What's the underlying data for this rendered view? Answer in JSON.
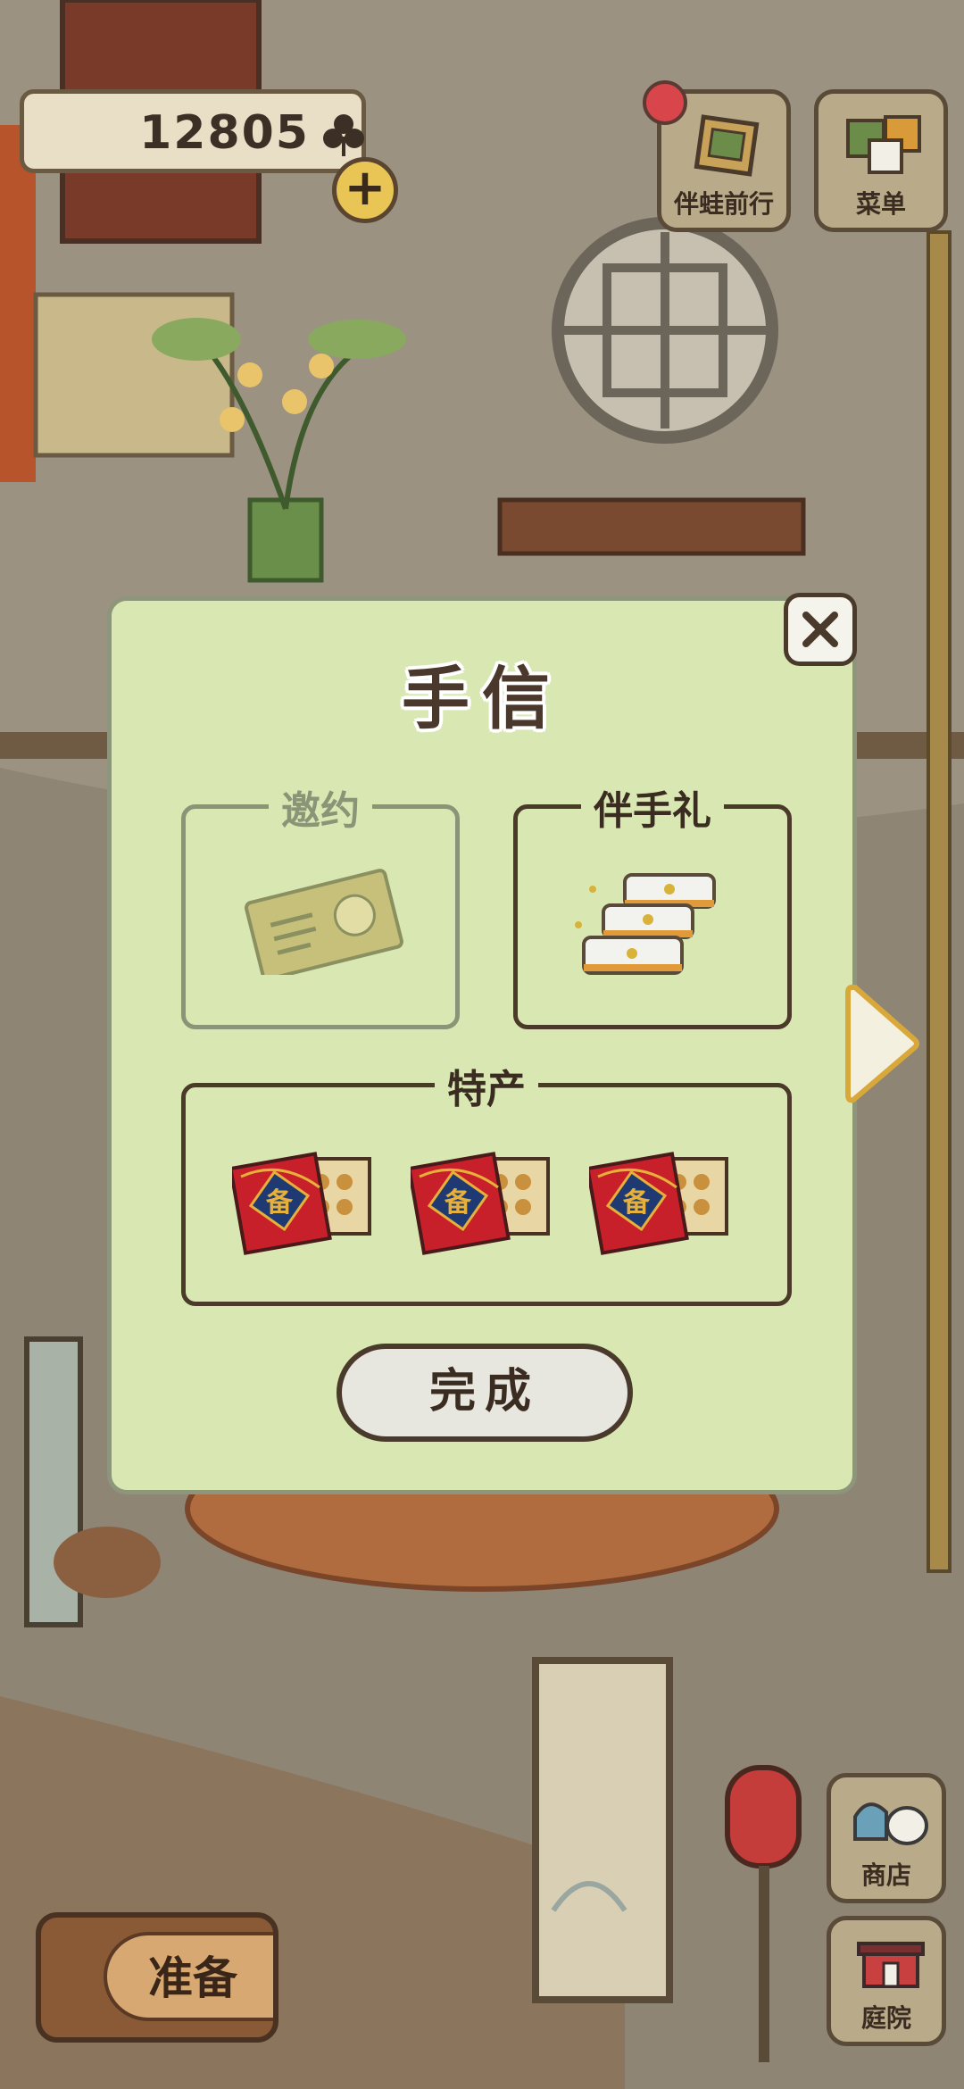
{
  "hud": {
    "clover_count": "12805",
    "clover_icon": "clover-icon",
    "plus_icon": "plus-icon"
  },
  "top_buttons": [
    {
      "label": "伴蛙前行",
      "icon": "journey-icon",
      "has_notification": true
    },
    {
      "label": "菜单",
      "icon": "menu-icon"
    }
  ],
  "side_buttons": [
    {
      "label": "商店",
      "icon": "shop-icon"
    },
    {
      "label": "庭院",
      "icon": "yard-icon"
    }
  ],
  "prepare_button": {
    "label": "准备"
  },
  "modal": {
    "title": "手信",
    "sections": {
      "invite": {
        "label": "邀约",
        "enabled": false,
        "item_icon": "invitation-ticket-icon"
      },
      "gift": {
        "label": "伴手礼",
        "enabled": true,
        "item_icon": "cake-stack-icon"
      },
      "specialty": {
        "label": "特产",
        "item_icons": [
          "specialty-box-icon",
          "specialty-box-icon",
          "specialty-box-icon"
        ],
        "box_char": "备"
      }
    },
    "done_label": "完成",
    "close_icon": "close-icon",
    "next_icon": "chevron-right-icon"
  },
  "colors": {
    "modal_bg": "#d9e8b3",
    "border_dark": "#4b3a2a",
    "specialty_red": "#c8202a",
    "specialty_blue": "#1f3a73"
  }
}
